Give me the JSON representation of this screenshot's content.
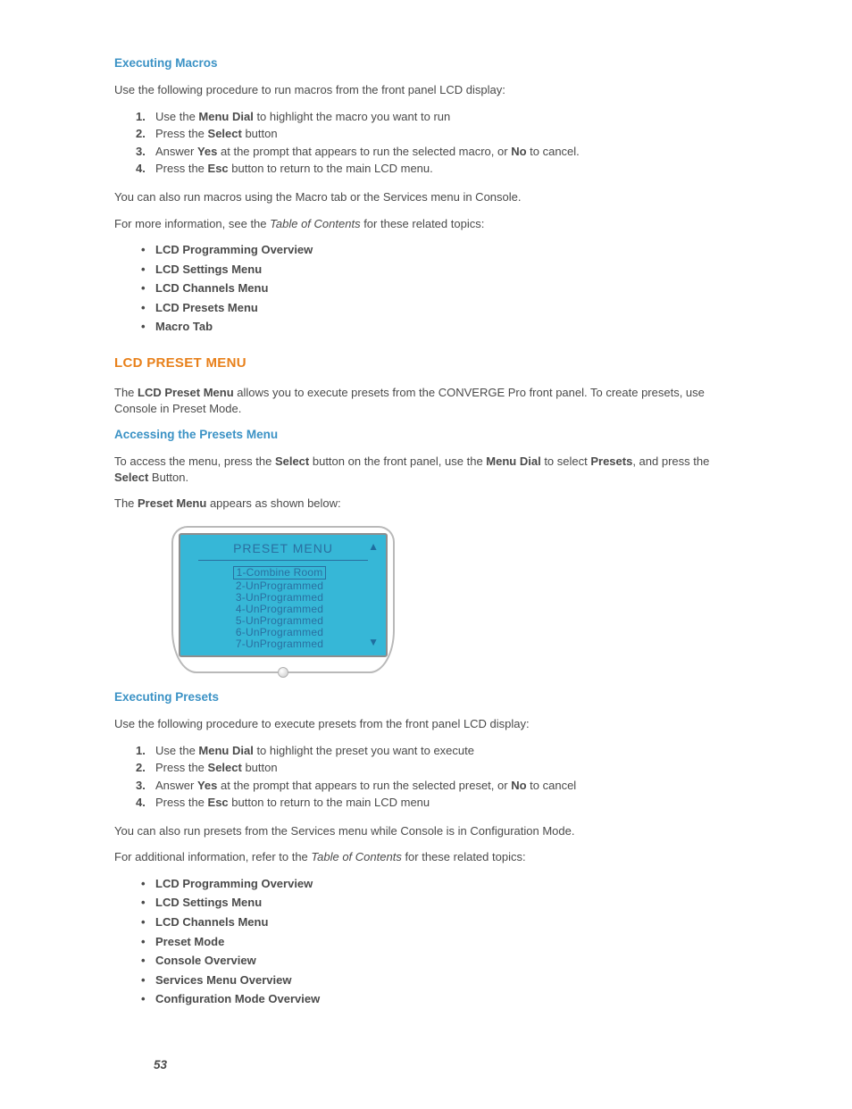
{
  "sec1": {
    "heading": "Executing Macros",
    "intro": "Use the following procedure to run macros from the front panel LCD display:",
    "steps": {
      "s1a": "Use the ",
      "s1b": "Menu Dial",
      "s1c": " to highlight the macro you want to run",
      "s2a": "Press the ",
      "s2b": "Select",
      "s2c": " button",
      "s3a": "Answer ",
      "s3b": "Yes",
      "s3c": " at the prompt that appears to run the selected macro, or ",
      "s3d": "No",
      "s3e": " to cancel.",
      "s4a": "Press the ",
      "s4b": "Esc",
      "s4c": " button to return to the main LCD menu."
    },
    "p1": "You can also run macros using the Macro tab or the Services menu in Console.",
    "p2a": "For more information, see the ",
    "p2b": "Table of Contents",
    "p2c": " for these related topics:",
    "topics": [
      "LCD Programming Overview",
      "LCD Settings Menu",
      "LCD Channels Menu",
      "LCD Presets Menu",
      "Macro Tab"
    ]
  },
  "sec2": {
    "heading": "LCD PRESET MENU",
    "p1a": "The ",
    "p1b": "LCD Preset Menu",
    "p1c": " allows you to execute presets from the CONVERGE Pro front panel. To create presets, use Console in Preset Mode.",
    "sub1": "Accessing the Presets Menu",
    "p2a": "To access the menu, press the ",
    "p2b": "Select",
    "p2c": " button on the front panel, use the ",
    "p2d": "Menu Dial",
    "p2e": " to select ",
    "p2f": "Presets",
    "p2g": ", and press the ",
    "p2h": "Select",
    "p2i": " Button.",
    "p3a": "The ",
    "p3b": "Preset Menu",
    "p3c": " appears as shown below:"
  },
  "lcd": {
    "title": "PRESET MENU",
    "rows": [
      "1-Combine Room",
      "2-UnProgrammed",
      "3-UnProgrammed",
      "4-UnProgrammed",
      "5-UnProgrammed",
      "6-UnProgrammed",
      "7-UnProgrammed"
    ]
  },
  "sec3": {
    "heading": "Executing Presets",
    "intro": "Use the following procedure to execute presets from the front panel LCD display:",
    "steps": {
      "s1a": "Use the ",
      "s1b": "Menu Dial",
      "s1c": " to highlight the preset you want to execute",
      "s2a": "Press the ",
      "s2b": "Select",
      "s2c": " button",
      "s3a": "Answer ",
      "s3b": "Yes",
      "s3c": " at the prompt that appears to run the selected preset, or ",
      "s3d": "No",
      "s3e": " to cancel",
      "s4a": "Press the ",
      "s4b": "Esc",
      "s4c": " button to return to the main LCD menu"
    },
    "p1": "You can also run presets from the Services menu while Console is in Configuration Mode.",
    "p2a": "For additional information, refer to the ",
    "p2b": "Table of Contents",
    "p2c": " for these related topics:",
    "topics": [
      "LCD Programming Overview",
      "LCD Settings Menu",
      "LCD Channels Menu",
      "Preset Mode",
      "Console Overview",
      "Services Menu Overview",
      "Configuration Mode Overview"
    ]
  },
  "page_number": "53"
}
